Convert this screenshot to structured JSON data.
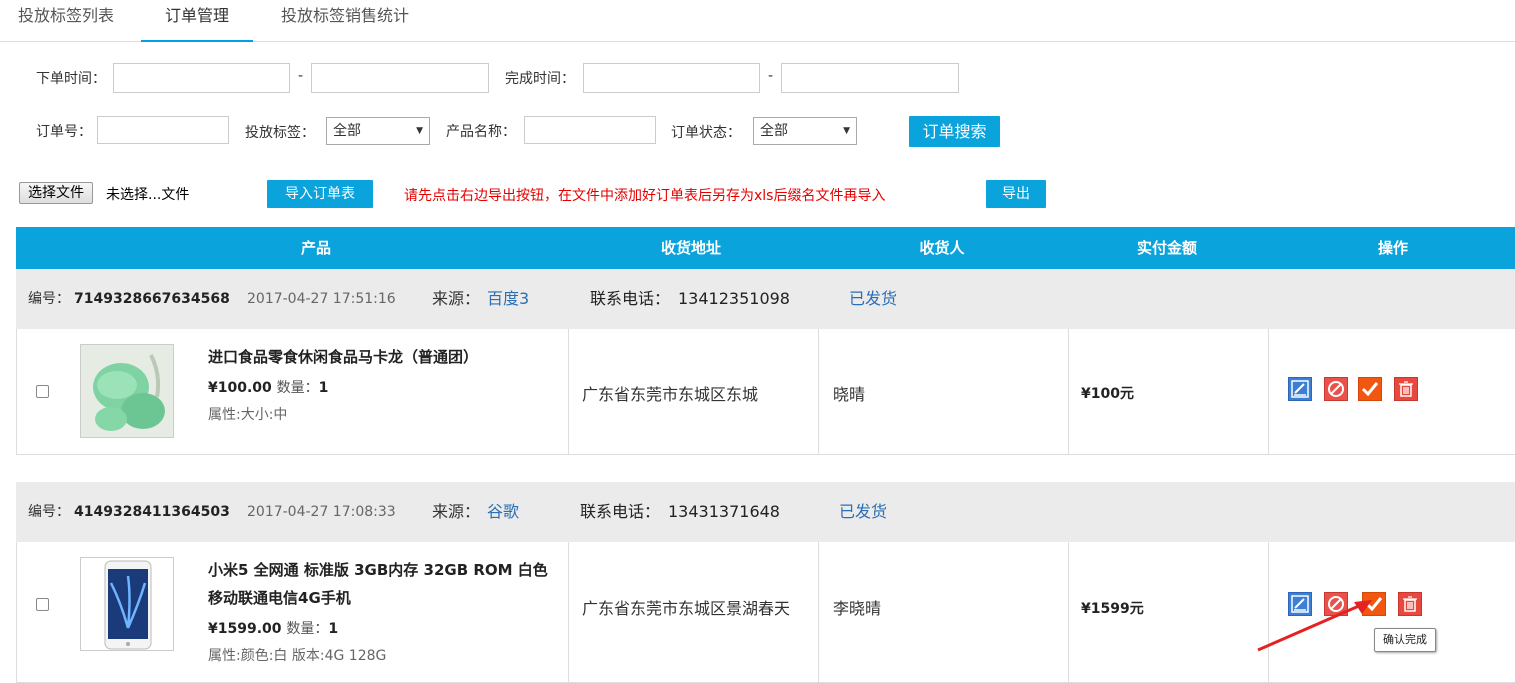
{
  "tabs": [
    {
      "label": "投放标签列表"
    },
    {
      "label": "订单管理"
    },
    {
      "label": "投放标签销售统计"
    }
  ],
  "filters": {
    "order_time_label": "下单时间：",
    "finish_time_label": "完成时间：",
    "dash": "-",
    "order_no_label": "订单号：",
    "tag_label": "投放标签：",
    "tag_value": "全部",
    "product_name_label": "产品名称：",
    "status_label": "订单状态：",
    "status_value": "全部",
    "search_button": "订单搜索"
  },
  "import": {
    "choose_file": "选择文件",
    "no_file": "未选择...文件",
    "import_button": "导入订单表",
    "note": "请先点击右边导出按钮，在文件中添加好订单表后另存为xls后缀名文件再导入",
    "export_button": "导出"
  },
  "table": {
    "headers": [
      "产品",
      "收货地址",
      "收货人",
      "实付金额",
      "操作"
    ]
  },
  "orders": [
    {
      "id_label": "编号：",
      "id": "7149328667634568",
      "time": "2017-04-27 17:51:16",
      "source_label": "来源：",
      "source": "百度3",
      "phone_label": "联系电话：",
      "phone": "13412351098",
      "status": "已发货",
      "product_name": "进口食品零食休闲食品马卡龙（普通团）",
      "price": "¥100.00",
      "qty_label": "数量：",
      "qty": "1",
      "attr": "属性:大小:中",
      "address": "广东省东莞市东城区东城",
      "receiver": "晓晴",
      "amount": "¥100元"
    },
    {
      "id_label": "编号：",
      "id": "4149328411364503",
      "time": "2017-04-27 17:08:33",
      "source_label": "来源：",
      "source": "谷歌",
      "phone_label": "联系电话：",
      "phone": "13431371648",
      "status": "已发货",
      "product_name_line1": "小米5 全网通 标准版 3GB内存 32GB ROM 白色",
      "product_name_line2": "移动联通电信4G手机",
      "price": "¥1599.00",
      "qty_label": "数量：",
      "qty": "1",
      "attr": "属性:颜色:白 版本:4G 128G",
      "address": "广东省东莞市东城区景湖春天",
      "receiver": "李晓晴",
      "amount": "¥1599元"
    }
  ],
  "tooltip": "确认完成",
  "colors": {
    "accent": "#0aa3dc",
    "edit_icon": "#3b7fd6",
    "cancel_icon": "#e8524a",
    "confirm_icon": "#f2570f",
    "delete_icon": "#e8483d",
    "note": "#e50000"
  }
}
